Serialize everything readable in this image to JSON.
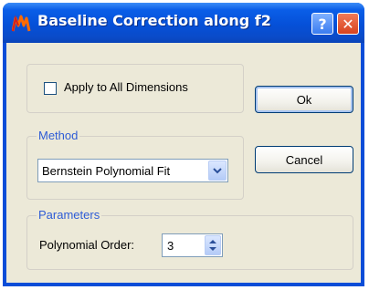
{
  "window": {
    "title": "Baseline Correction along f2",
    "help_glyph": "?",
    "close_glyph": "✕"
  },
  "options": {
    "apply_all_label": "Apply to All Dimensions",
    "apply_all_checked": false
  },
  "method": {
    "group_title": "Method",
    "selected": "Bernstein Polynomial Fit"
  },
  "parameters": {
    "group_title": "Parameters",
    "order_label": "Polynomial Order:",
    "order_value": "3"
  },
  "buttons": {
    "ok_label": "Ok",
    "cancel_label": "Cancel"
  },
  "colors": {
    "titlebar": "#0550d8",
    "client_bg": "#ece9d8",
    "group_title": "#2e5cd6"
  }
}
